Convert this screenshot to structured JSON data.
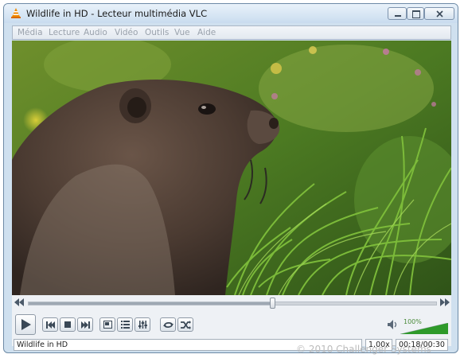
{
  "window": {
    "title": "Wildlife in HD - Lecteur multimédia VLC"
  },
  "menu": {
    "items": [
      "Média",
      "Lecture",
      "Audio",
      "Vidéo",
      "Outils",
      "Vue",
      "Aide"
    ]
  },
  "playback": {
    "seek_progress": 0.6,
    "volume_label": "100%",
    "volume_level": 1.0
  },
  "status": {
    "title": "Wildlife in HD",
    "speed": "1.00x",
    "time": "00:18/00:30"
  },
  "watermark": "© 2010 Challenger Systems",
  "icons": {
    "app": "vlc-cone-icon",
    "play": "play-icon",
    "prev": "previous-icon",
    "stop": "stop-icon",
    "next": "next-icon",
    "fullscreen": "fullscreen-icon",
    "playlist": "playlist-icon",
    "extended": "equalizer-icon",
    "loop": "loop-icon",
    "random": "shuffle-icon",
    "volume": "speaker-icon"
  },
  "colors": {
    "volume_fill": "#2e9a2a",
    "window_frame": "#cfe0ef"
  }
}
